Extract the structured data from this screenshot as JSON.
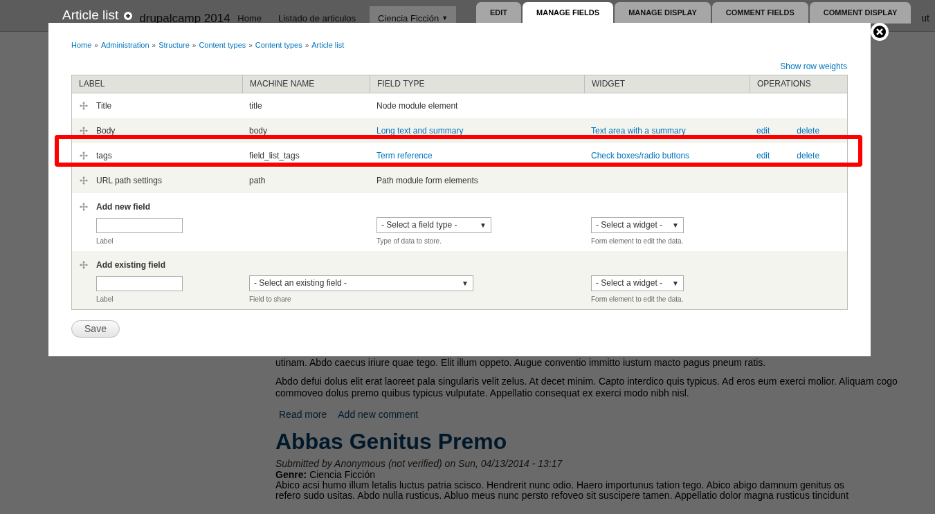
{
  "site": {
    "title": "Article list",
    "logo": "drupalcamp 2014",
    "nav": [
      {
        "label": "Home",
        "selected": false
      },
      {
        "label": "Listado de articulos",
        "selected": false
      },
      {
        "label": "Ciencia Ficción",
        "selected": true,
        "dropdown": "▼"
      }
    ],
    "user_link": "ut"
  },
  "background": {
    "paragraphs": [
      "utinam. Abdo caecus iriure quae tego. Elit illum oppeto. Augue conventio immitto iustum macto pagus pneum ratis.",
      "Abdo defui dolus elit erat laoreet pala singularis velit zelus. At decet minim. Capto interdico quis typicus. Ad eros eum exerci molior. Aliquam cogo commoveo dolus premo quibus typicus vulputate. Appellatio consequat ex exerci modo nibh nisl."
    ],
    "links": [
      "Read more",
      "Add new comment"
    ],
    "article_title": "Abbas Genitus Premo",
    "submitted": "Submitted by Anonymous (not verified) on Sun, 04/13/2014 - 13:17",
    "genre_label": "Genre:",
    "genre_value": "Ciencia Ficción",
    "body_lines": [
      "Abico acsi humo illum letalis luctus patria scisco. Hendrerit nunc odio. Haero importunus tation tego. Abico abigo damnum genitus os",
      "refero sudo usitas. Abdo nulla rusticus. Abluo meus nunc persto refoveo sit suscipere tamen. Appellatio dolor magna rusticus tincidunt"
    ]
  },
  "tabs": [
    {
      "label": "EDIT",
      "selected": false
    },
    {
      "label": "MANAGE FIELDS",
      "selected": true
    },
    {
      "label": "MANAGE DISPLAY",
      "selected": false
    },
    {
      "label": "COMMENT FIELDS",
      "selected": false
    },
    {
      "label": "COMMENT DISPLAY",
      "selected": false
    }
  ],
  "breadcrumb": [
    {
      "label": "Home"
    },
    {
      "separator": "»",
      "label": "Administration"
    },
    {
      "separator": "»",
      "label": "Structure"
    },
    {
      "separator": "»",
      "label": "Content types"
    },
    {
      "separator": "»",
      "label": "Content types"
    },
    {
      "separator": "»",
      "label": "Article list"
    }
  ],
  "show_row_weights": "Show row weights",
  "table": {
    "columns": [
      "LABEL",
      "MACHINE NAME",
      "FIELD TYPE",
      "WIDGET",
      "OPERATIONS"
    ],
    "rows": [
      {
        "label": "Title",
        "machine_name": "title",
        "field_type": "Node module element",
        "field_type_link": false,
        "highlighted": false
      },
      {
        "label": "Body",
        "machine_name": "body",
        "field_type": "Long text and summary",
        "field_type_link": true,
        "widget": "Text area with a summary",
        "operations": [
          "edit",
          "delete"
        ],
        "highlighted": false
      },
      {
        "label": "tags",
        "machine_name": "field_list_tags",
        "field_type": "Term reference",
        "field_type_link": true,
        "widget": "Check boxes/radio buttons",
        "operations": [
          "edit",
          "delete"
        ],
        "highlighted": true
      },
      {
        "label": "URL path settings",
        "machine_name": "path",
        "field_type": "Path module form elements",
        "field_type_link": false,
        "highlighted": false
      }
    ],
    "add_new": {
      "title": "Add new field",
      "label_hint": "Label",
      "type_select": {
        "text": "- Select a field type -",
        "arrow": "▼"
      },
      "type_hint": "Type of data to store.",
      "widget_select": {
        "text": "- Select a widget -",
        "arrow": "▼"
      },
      "widget_hint": "Form element to edit the data."
    },
    "add_existing": {
      "title": "Add existing field",
      "label_hint": "Label",
      "field_select": {
        "text": "- Select an existing field -",
        "arrow": "▼"
      },
      "field_hint": "Field to share",
      "widget_select": {
        "text": "- Select a widget -",
        "arrow": "▼"
      },
      "widget_hint": "Form element to edit the data."
    }
  },
  "save": "Save"
}
